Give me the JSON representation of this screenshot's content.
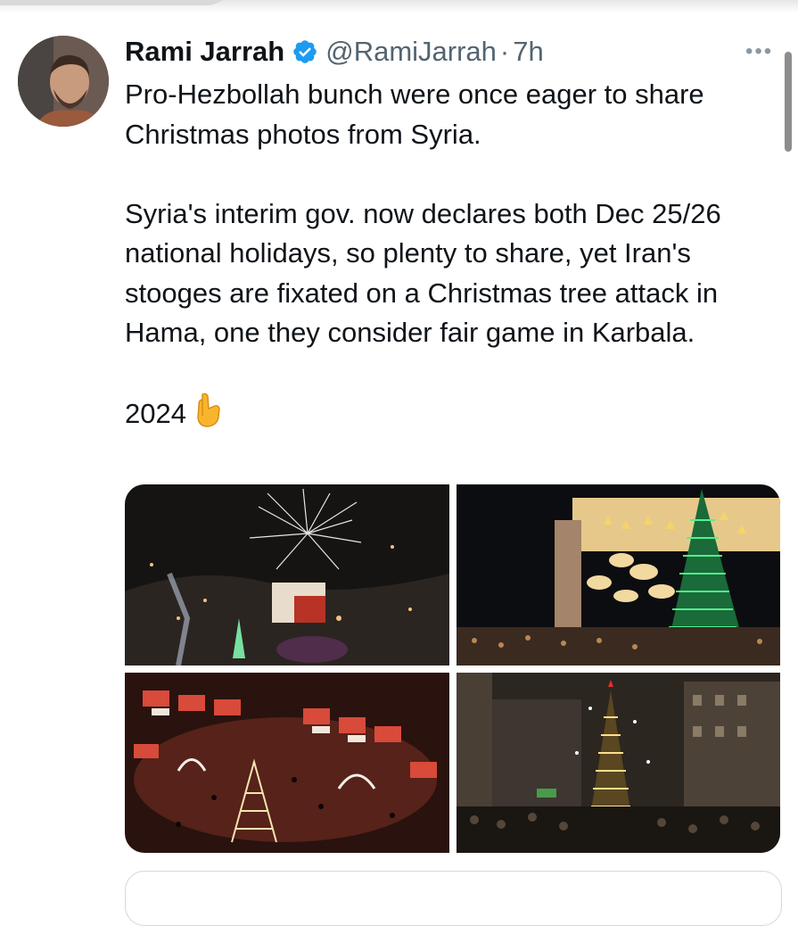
{
  "tweet": {
    "author_name": "Rami Jarrah",
    "handle": "@RamiJarrah",
    "separator": "·",
    "time": "7h",
    "more_label": "•••",
    "text": "Pro-Hezbollah bunch were once eager to share Christmas photos from Syria.\n\nSyria's interim gov. now declares both Dec 25/26 national holidays, so plenty to share, yet Iran's stooges are fixated on a Christmas tree attack in Hama, one they consider fair game in Karbala.\n\n2024",
    "emoji": "backhand-index-pointing-down"
  },
  "media": {
    "count": 4,
    "photos": [
      "fireworks-over-town",
      "lit-christmas-tree-plaza",
      "market-stalls-aerial",
      "tree-crowd-night"
    ]
  },
  "colors": {
    "text": "#0f1419",
    "secondary": "#536471",
    "verified": "#1d9bf0",
    "border": "#cfd9de"
  }
}
